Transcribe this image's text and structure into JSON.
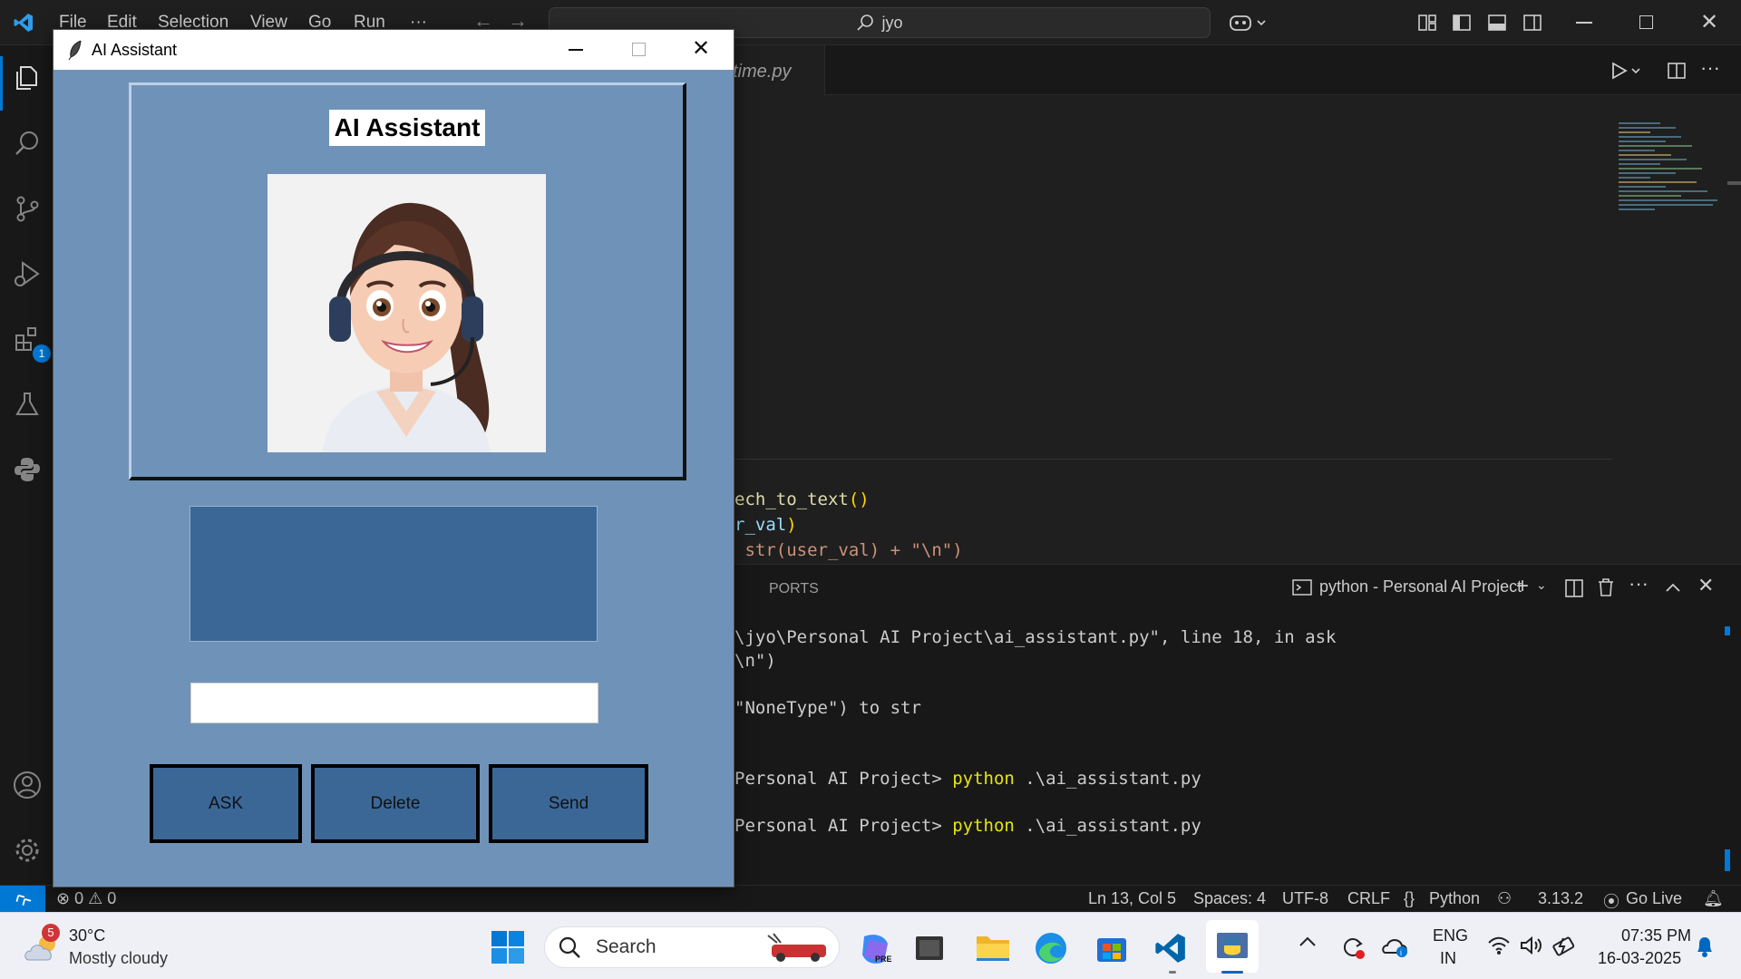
{
  "vscode": {
    "menu": [
      "File",
      "Edit",
      "Selection",
      "View",
      "Go",
      "Run",
      "···"
    ],
    "search_text": "jyo",
    "tab_label": "time.py",
    "code_lines": [
      {
        "t1": "ech_to_text",
        "t2": "()",
        "t3": ""
      },
      {
        "t1": "r_val",
        "t2": ")",
        "t3": ""
      },
      {
        "t1": " str(user_val) + \"\\n\")",
        "t2": "",
        "t3": ""
      }
    ],
    "extensions_badge": "1",
    "panel": {
      "ports_tab": "PORTS",
      "terminal_name": "python - Personal AI Project"
    },
    "terminal_lines": [
      "\\jyo\\Personal AI Project\\ai_assistant.py\", line 18, in ask",
      "\\n\")",
      "\"NoneType\") to str"
    ],
    "prompt_lines": [
      {
        "prefix": "Personal AI Project> ",
        "cmd": "python",
        "arg": " .\\ai_assistant.py"
      },
      {
        "prefix": "Personal AI Project> ",
        "cmd": "python",
        "arg": " .\\ai_assistant.py"
      }
    ],
    "status": {
      "errors": "0",
      "warnings": "0",
      "position": "Ln 13, Col 5",
      "spaces": "Spaces: 4",
      "encoding": "UTF-8",
      "eol": "CRLF",
      "language": "Python",
      "interpreter": "3.13.2",
      "golive": "Go Live"
    }
  },
  "tk_window": {
    "title": "AI Assistant",
    "heading": "AI Assistant",
    "output_text": "",
    "input_value": "",
    "buttons": {
      "ask": "ASK",
      "delete": "Delete",
      "send": "Send"
    }
  },
  "taskbar": {
    "weather_badge": "5",
    "temperature": "30°C",
    "condition": "Mostly cloudy",
    "search_label": "Search",
    "lang_top": "ENG",
    "lang_bottom": "IN",
    "time": "07:35 PM",
    "date": "16-03-2025"
  },
  "colors": {
    "tk_bg": "#6f93b8",
    "tk_button": "#3a6796",
    "vscode_bg": "#1f1f1f",
    "accent": "#0078d4"
  }
}
